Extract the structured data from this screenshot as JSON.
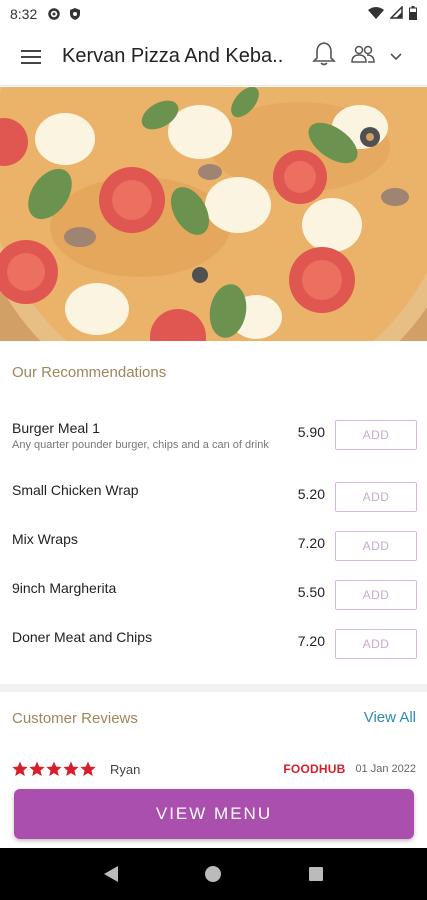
{
  "status_bar": {
    "time": "8:32"
  },
  "app_bar": {
    "title": "Kervan Pizza And Keba.."
  },
  "recommendations": {
    "title": "Our Recommendations",
    "items": [
      {
        "name": "Burger Meal 1",
        "description": "Any quarter pounder burger, chips and a can of drink",
        "price": "5.90",
        "add_label": "ADD"
      },
      {
        "name": "Small Chicken Wrap",
        "description": "",
        "price": "5.20",
        "add_label": "ADD"
      },
      {
        "name": "Mix Wraps",
        "description": "",
        "price": "7.20",
        "add_label": "ADD"
      },
      {
        "name": "9inch Margherita",
        "description": "",
        "price": "5.50",
        "add_label": "ADD"
      },
      {
        "name": "Doner Meat and Chips",
        "description": "",
        "price": "7.20",
        "add_label": "ADD"
      }
    ]
  },
  "reviews": {
    "title": "Customer Reviews",
    "view_all": "View All",
    "items": [
      {
        "rating": 5,
        "reviewer": "Ryan",
        "source": "FOODHUB",
        "date": "01 Jan 2022"
      }
    ]
  },
  "view_menu_label": "VIEW MENU",
  "colors": {
    "accent": "#aa4fae",
    "section_title": "#a0855b",
    "link": "#2a8cb5",
    "star": "#d61f2a"
  },
  "icons": [
    "settings-icon",
    "shield-icon",
    "wifi-icon",
    "signal-icon",
    "battery-icon",
    "hamburger-menu-icon",
    "bell-icon",
    "group-icon",
    "chevron-down-icon",
    "back-icon",
    "home-icon",
    "recents-icon"
  ]
}
